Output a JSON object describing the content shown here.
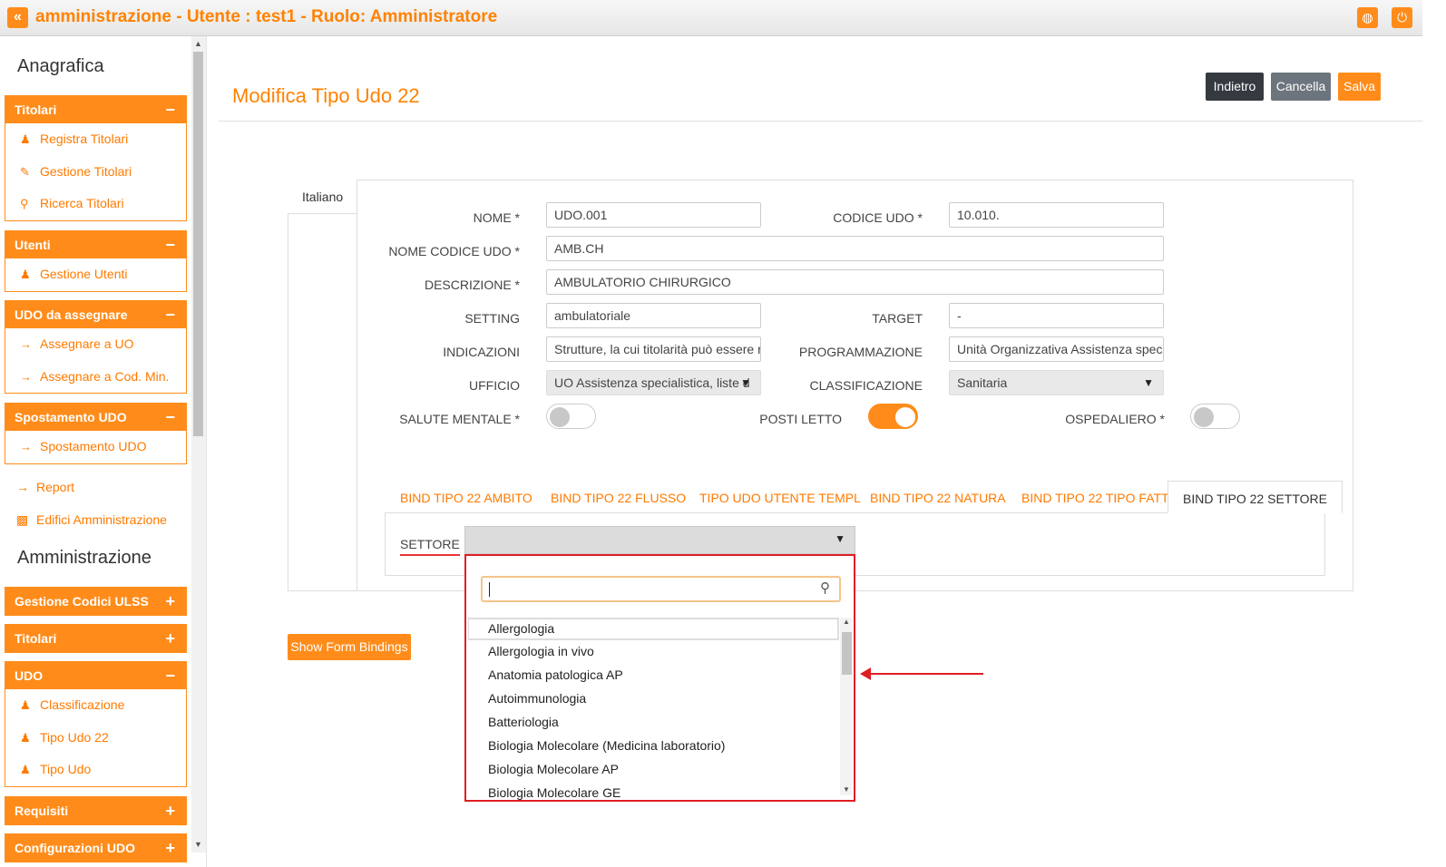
{
  "topbar": {
    "back_icon": "double-chevron-left-icon",
    "title": "amministrazione - Utente : test1 - Ruolo: Amministratore",
    "globe_icon": "globe-icon",
    "power_icon": "power-icon"
  },
  "sidebar": {
    "anagrafica_title": "Anagrafica",
    "titolari": {
      "label": "Titolari",
      "toggle": "−",
      "items": [
        "Registra Titolari",
        "Gestione Titolari",
        "Ricerca Titolari"
      ]
    },
    "utenti": {
      "label": "Utenti",
      "toggle": "−",
      "items": [
        "Gestione Utenti"
      ]
    },
    "udo_assegnare": {
      "label": "UDO da assegnare",
      "toggle": "−",
      "items": [
        "Assegnare a UO",
        "Assegnare a Cod. Min."
      ]
    },
    "spostamento": {
      "label": "Spostamento UDO",
      "toggle": "−",
      "items": [
        "Spostamento UDO"
      ]
    },
    "report": "Report",
    "edifici": "Edifici Amministrazione",
    "amministrazione_title": "Amministrazione",
    "gestione_codici": {
      "label": "Gestione Codici ULSS",
      "toggle": "+"
    },
    "titolari2": {
      "label": "Titolari",
      "toggle": "+"
    },
    "udo": {
      "label": "UDO",
      "toggle": "−",
      "items": [
        "Classificazione",
        "Tipo Udo 22",
        "Tipo Udo"
      ]
    },
    "requisiti": {
      "label": "Requisiti",
      "toggle": "+"
    },
    "configurazioni": {
      "label": "Configurazioni UDO",
      "toggle": "+"
    }
  },
  "header": {
    "page_title": "Modifica Tipo Udo 22",
    "btn_indietro": "Indietro",
    "btn_cancella": "Cancella",
    "btn_salva": "Salva"
  },
  "form": {
    "lang_tab": "Italiano",
    "nome_label": "NOME *",
    "nome_value": "UDO.001",
    "codice_label": "CODICE UDO *",
    "codice_value": "10.010.",
    "nome_codice_label": "NOME CODICE UDO *",
    "nome_codice_value": "AMB.CH",
    "descrizione_label": "DESCRIZIONE *",
    "descrizione_value": "AMBULATORIO CHIRURGICO",
    "setting_label": "SETTING",
    "setting_value": "ambulatoriale",
    "target_label": "TARGET",
    "target_value": "-",
    "indicazioni_label": "INDICAZIONI",
    "indicazioni_value": "Strutture, la cui titolarità può essere r",
    "programmazione_label": "PROGRAMMAZIONE",
    "programmazione_value": "Unità Organizzativa Assistenza specia",
    "ufficio_label": "UFFICIO",
    "ufficio_value": "UO Assistenza specialistica, liste d",
    "classificazione_label": "CLASSIFICAZIONE",
    "classificazione_value": "Sanitaria",
    "salute_label": "SALUTE MENTALE *",
    "salute_on": false,
    "posti_label": "POSTI LETTO",
    "posti_on": true,
    "ospedaliero_label": "OSPEDALIERO *",
    "ospedaliero_on": false
  },
  "tabs": [
    "BIND TIPO 22 AMBITO",
    "BIND TIPO 22 FLUSSO",
    "TIPO UDO UTENTE TEMPL",
    "BIND TIPO 22 NATURA",
    "BIND TIPO 22 TIPO FATT",
    "BIND TIPO 22 SETTORE"
  ],
  "settore": {
    "label": "SETTORE",
    "search_icon": "magnifier-icon",
    "options": [
      "Allergologia",
      "Allergologia in vivo",
      "Anatomia patologica AP",
      "Autoimmunologia",
      "Batteriologia",
      "Biologia Molecolare (Medicina laboratorio)",
      "Biologia Molecolare AP",
      "Biologia Molecolare GE"
    ]
  },
  "show_form_bindings": "Show Form Bindings",
  "colors": {
    "accent": "#ff8c1a",
    "annotation": "#e01e24",
    "btn_dark": "#343a40",
    "btn_gray": "#6c757d"
  }
}
